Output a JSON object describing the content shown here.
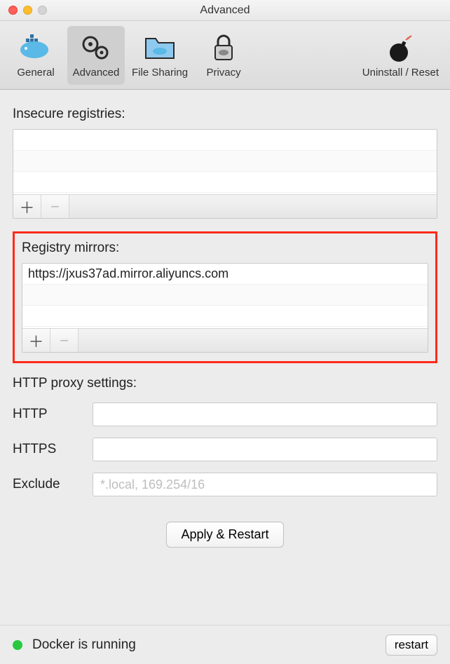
{
  "window": {
    "title": "Advanced"
  },
  "toolbar": {
    "items": [
      {
        "label": "General"
      },
      {
        "label": "Advanced"
      },
      {
        "label": "File Sharing"
      },
      {
        "label": "Privacy"
      }
    ],
    "uninstall_label": "Uninstall / Reset"
  },
  "insecure": {
    "label": "Insecure registries:"
  },
  "mirrors": {
    "label": "Registry mirrors:",
    "items": [
      "https://jxus37ad.mirror.aliyuncs.com"
    ]
  },
  "proxy": {
    "title": "HTTP proxy settings:",
    "http_label": "HTTP",
    "https_label": "HTTPS",
    "exclude_label": "Exclude",
    "http_value": "",
    "https_value": "",
    "exclude_value": "",
    "exclude_placeholder": "*.local, 169.254/16"
  },
  "apply": {
    "label": "Apply & Restart"
  },
  "status": {
    "text": "Docker is running",
    "restart_label": "restart"
  }
}
